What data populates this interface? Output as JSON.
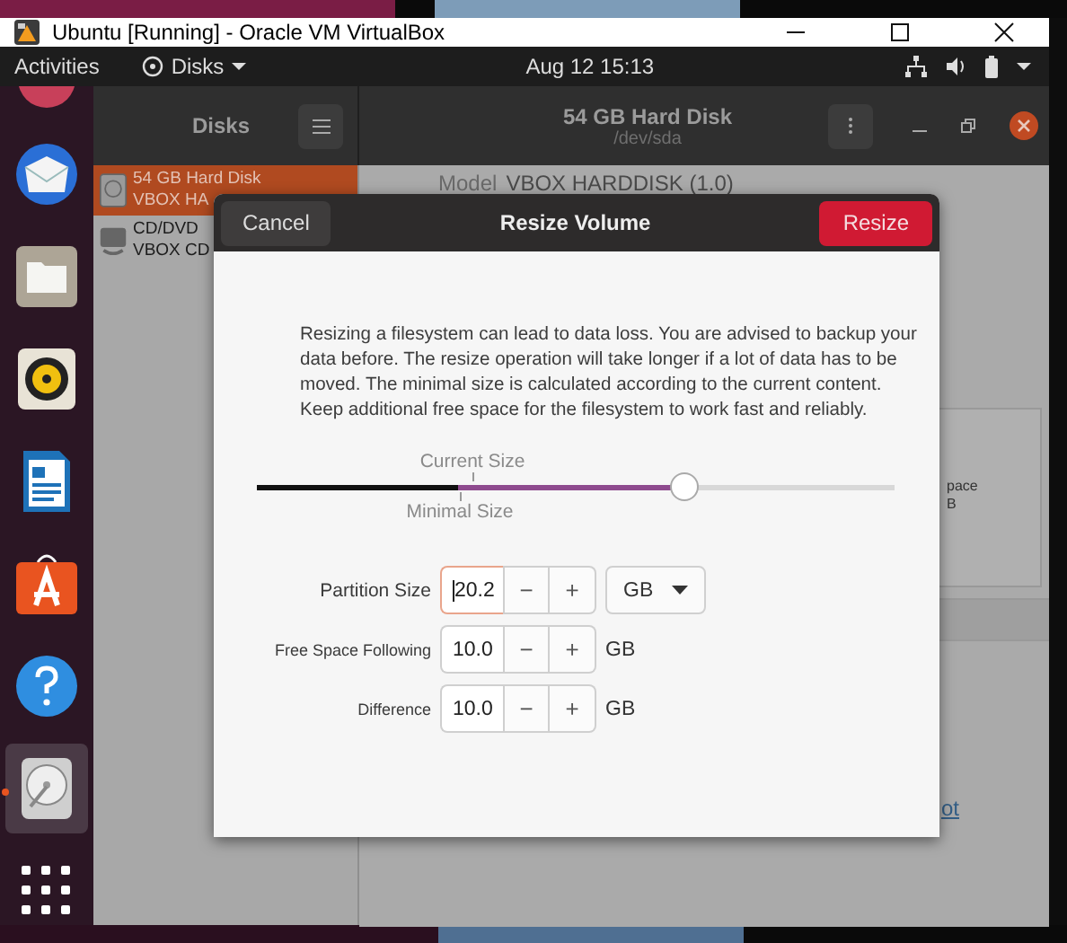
{
  "vm_window": {
    "title": "Ubuntu [Running] - Oracle VM VirtualBox"
  },
  "top_bar": {
    "activities": "Activities",
    "app_menu": "Disks",
    "clock": "Aug 12  15:13"
  },
  "dock": {
    "items": [
      {
        "kind": "partial",
        "running": false,
        "selected": false
      },
      {
        "kind": "mail",
        "running": false,
        "selected": false
      },
      {
        "kind": "files",
        "running": false,
        "selected": false
      },
      {
        "kind": "music",
        "running": false,
        "selected": false
      },
      {
        "kind": "writer",
        "running": false,
        "selected": false
      },
      {
        "kind": "store",
        "running": false,
        "selected": false
      },
      {
        "kind": "help",
        "running": false,
        "selected": false
      },
      {
        "kind": "disks",
        "running": true,
        "selected": true
      },
      {
        "kind": "grid",
        "running": false,
        "selected": false
      }
    ]
  },
  "disks_app": {
    "sidebar_title": "Disks",
    "drive_title": "54 GB Hard Disk",
    "drive_path": "/dev/sda",
    "drives": [
      {
        "kind": "hdd",
        "name": "54 GB Hard Disk",
        "model": "VBOX HA",
        "selected": true
      },
      {
        "kind": "optical",
        "name": "CD/DVD",
        "model": "VBOX CD",
        "selected": false
      }
    ],
    "model_label": "Model",
    "model_value": "VBOX HARDDISK (1.0)",
    "card_lines": [
      "pace",
      "B"
    ],
    "link": "ot"
  },
  "resize_dialog": {
    "title": "Resize Volume",
    "cancel": "Cancel",
    "confirm": "Resize",
    "message": "Resizing a filesystem can lead to data loss. You are advised to backup your data before. The resize operation will take longer if a lot of data has to be moved. The minimal size is calculated according to the current content. Keep additional free space for the filesystem to work fast and reliably.",
    "slider": {
      "level": 0.67,
      "current_label": "Current Size",
      "minimal_label": "Minimal Size"
    },
    "fields": [
      {
        "kind": "dropdown",
        "label": "Partition Size",
        "value": "20.2",
        "focused": true,
        "minus": "−",
        "plus": "+",
        "unit": "GB"
      },
      {
        "kind": "text",
        "label": "Free Space Following",
        "value": "10.0",
        "focused": false,
        "minus": "−",
        "plus": "+",
        "unit": "GB"
      },
      {
        "kind": "text",
        "label": "Difference",
        "value": "10.0",
        "focused": false,
        "minus": "−",
        "plus": "+",
        "unit": "GB"
      }
    ]
  }
}
